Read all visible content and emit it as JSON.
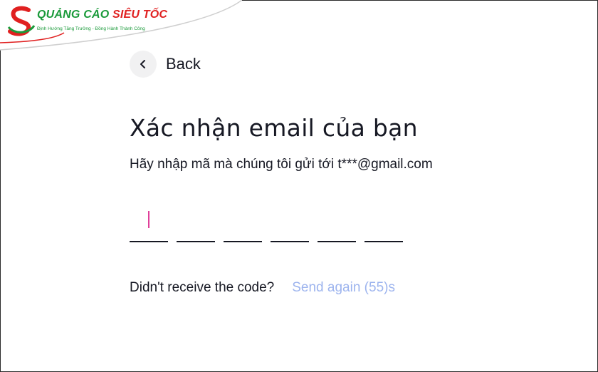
{
  "logo": {
    "title_part1": "QUẢNG CÁO",
    "title_part2": "SIÊU TỐC",
    "tagline": "Định Hướng Tăng Trưởng - Đồng Hành Thành Công",
    "colors": {
      "green": "#1a9a3a",
      "red": "#e02020"
    }
  },
  "nav": {
    "back_icon": "chevron-left-icon",
    "back_label": "Back"
  },
  "verify": {
    "title": "Xác nhận email của bạn",
    "instruction": "Hãy nhập mã mà chúng tôi gửi tới t***@gmail.com",
    "code_digits": [
      "",
      "",
      "",
      "",
      "",
      ""
    ],
    "caret_color": "#e0409a"
  },
  "resend": {
    "question": "Didn't receive the code?",
    "link_label": "Send again (55)s",
    "link_color": "#9db4ee"
  }
}
